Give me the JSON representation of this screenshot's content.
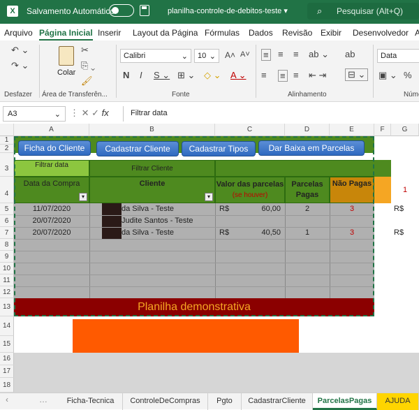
{
  "titlebar": {
    "autosave_label": "Salvamento Automático",
    "filename": "planilha-controle-de-debitos-teste",
    "search_placeholder": "Pesquisar (Alt+Q)"
  },
  "menu": [
    "Arquivo",
    "Página Inicial",
    "Inserir",
    "Layout da Página",
    "Fórmulas",
    "Dados",
    "Revisão",
    "Exibir",
    "Desenvolvedor",
    "A"
  ],
  "ribbon": {
    "desfazer": "Desfazer",
    "colar": "Colar",
    "clipboard_group": "Área de Transferên...",
    "font_name": "Calibri",
    "font_size": "10",
    "font_group": "Fonte",
    "align_group": "Alinhamento",
    "number_format": "Data",
    "number_group": "Núme"
  },
  "formula": {
    "cell_ref": "A3",
    "content": "Filtrar data"
  },
  "columns": [
    "A",
    "B",
    "C",
    "D",
    "E",
    "F",
    "G"
  ],
  "rows": [
    "1",
    "2",
    "3",
    "4",
    "5",
    "6",
    "7",
    "8",
    "9",
    "10",
    "11",
    "12",
    "13",
    "14",
    "15",
    "16",
    "17",
    "18"
  ],
  "buttons": {
    "ficha": "Ficha do Cliente",
    "cadastrar_cliente": "Cadastrar Cliente",
    "cadastrar_tipos": "Cadastrar Tipos",
    "dar_baixa": "Dar Baixa em Parcelas"
  },
  "table": {
    "filter_date": "Filtrar data",
    "filter_client": "Filtrar Cliente",
    "h_date": "Data da Compra",
    "h_client": "Cliente",
    "h_value": "Valor das parcelas",
    "h_value_sub": "(se houver)",
    "h_paid": "Parcelas Pagas",
    "h_unpaid": "Não Pagas",
    "currency": "R$",
    "rows": [
      {
        "date": "11/07/2020",
        "client": "da Silva - Teste",
        "value": "60,00",
        "paid": "2",
        "unpaid": "3"
      },
      {
        "date": "20/07/2020",
        "client": "Judite Santos - Teste",
        "value": "",
        "paid": "",
        "unpaid": ""
      },
      {
        "date": "20/07/2020",
        "client": "da Silva - Teste",
        "value": "40,50",
        "paid": "1",
        "unpaid": "3"
      }
    ],
    "footer": "Planilha demonstrativa"
  },
  "right_col": {
    "g4": "1",
    "f5": "R$",
    "f7": "R$",
    "g5": "",
    "g7": ""
  },
  "tabs": [
    "Ficha-Tecnica",
    "ControleDeCompras",
    "Pgto",
    "CadastrarCliente",
    "ParcelasPagas",
    "AJUDA"
  ],
  "colors": {
    "excel_green": "#217346",
    "table_green": "#4e8a1f",
    "filter_light": "#8cc63f",
    "gray": "#b0b0b0",
    "orange": "#ff5a00",
    "darkred": "#8b0000",
    "unpaid_header": "#c8860a"
  }
}
